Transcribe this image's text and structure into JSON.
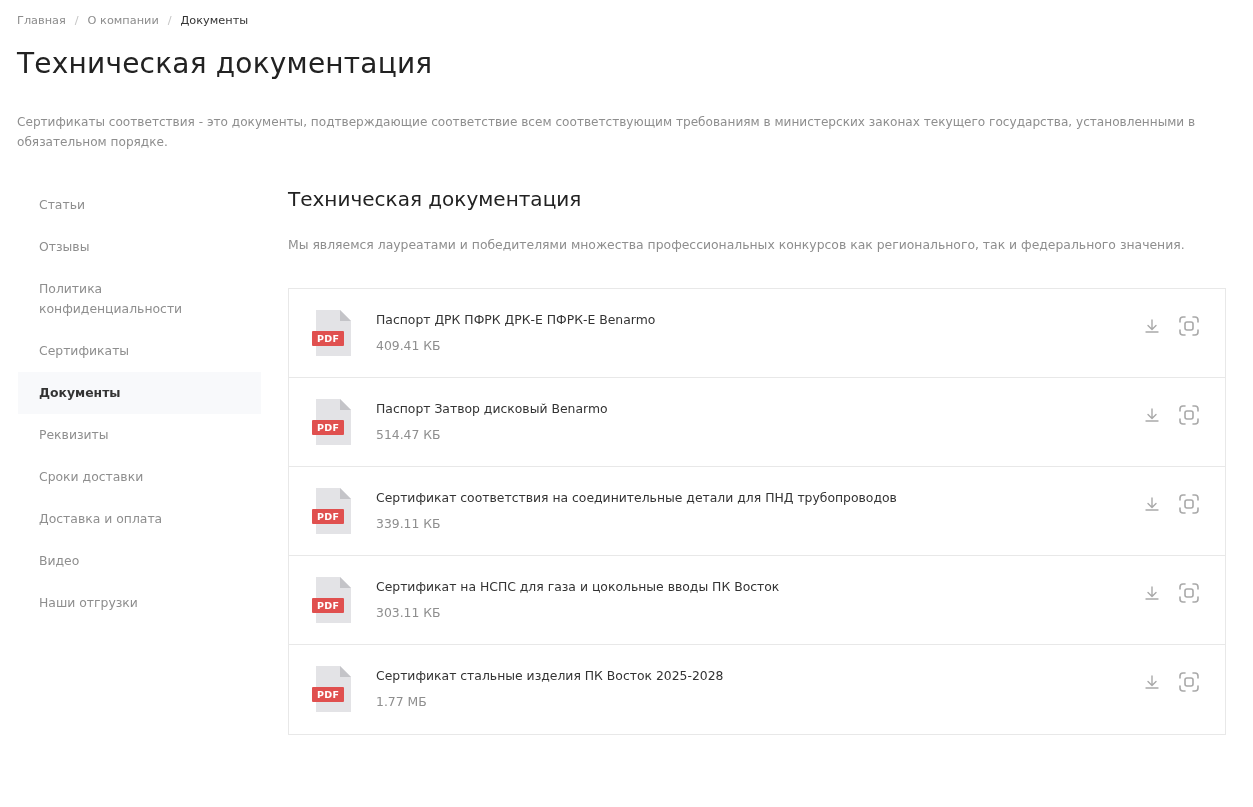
{
  "breadcrumbs": {
    "separator": "/",
    "items": [
      {
        "label": "Главная",
        "current": false
      },
      {
        "label": "О компании",
        "current": false
      },
      {
        "label": "Документы",
        "current": true
      }
    ]
  },
  "page_title": "Техническая документация",
  "intro": "Сертификаты соответствия - это документы, подтверждающие соответствие всем соответствующим требованиям в министерских законах текущего государства, установленными в обязательном порядке.",
  "sidebar": {
    "items": [
      {
        "label": "Статьи",
        "selected": false
      },
      {
        "label": "Отзывы",
        "selected": false
      },
      {
        "label": "Политика конфиденциальности",
        "selected": false
      },
      {
        "label": "Сертификаты",
        "selected": false
      },
      {
        "label": "Документы",
        "selected": true
      },
      {
        "label": "Реквизиты",
        "selected": false
      },
      {
        "label": "Сроки доставки",
        "selected": false
      },
      {
        "label": "Доставка и оплата",
        "selected": false
      },
      {
        "label": "Видео",
        "selected": false
      },
      {
        "label": "Наши отгрузки",
        "selected": false
      }
    ]
  },
  "section": {
    "title": "Техническая документация",
    "description": "Мы являемся лауреатами и победителями множества профессиональных конкурсов как регионального, так и федерального значения.",
    "documents": [
      {
        "file_type": "PDF",
        "title": "Паспорт ДРК ПФРК ДРК-Е ПФРК-Е Benarmo",
        "size": "409.41 КБ"
      },
      {
        "file_type": "PDF",
        "title": "Паспорт Затвор дисковый Benarmo",
        "size": "514.47 КБ"
      },
      {
        "file_type": "PDF",
        "title": "Сертификат соответствия на соединительные детали для ПНД трубопроводов",
        "size": "339.11 КБ"
      },
      {
        "file_type": "PDF",
        "title": "Сертификат на НСПС для газа и цокольные вводы ПК Восток",
        "size": "303.11 КБ"
      },
      {
        "file_type": "PDF",
        "title": "Сертификат стальные изделия ПК Восток 2025-2028",
        "size": "1.77 МБ"
      }
    ]
  }
}
